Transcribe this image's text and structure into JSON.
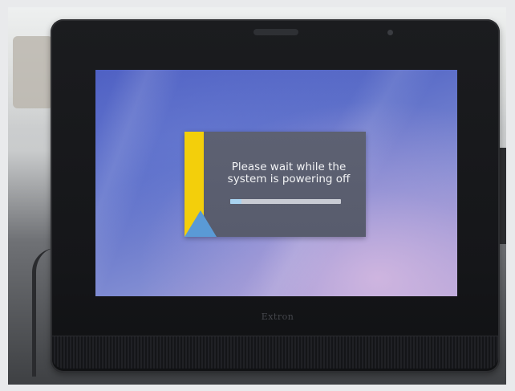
{
  "device": {
    "brand": "Extron"
  },
  "dialog": {
    "message_line1": "Please wait while the",
    "message_line2": "system is powering off",
    "progress_fraction": 0.1
  },
  "colors": {
    "accent_yellow": "#f3cf0b",
    "accent_blue": "#5a9ad6",
    "dialog_bg": "#5d6172",
    "progress_track": "#c9ccd4",
    "progress_fill": "#a9d3f0"
  }
}
